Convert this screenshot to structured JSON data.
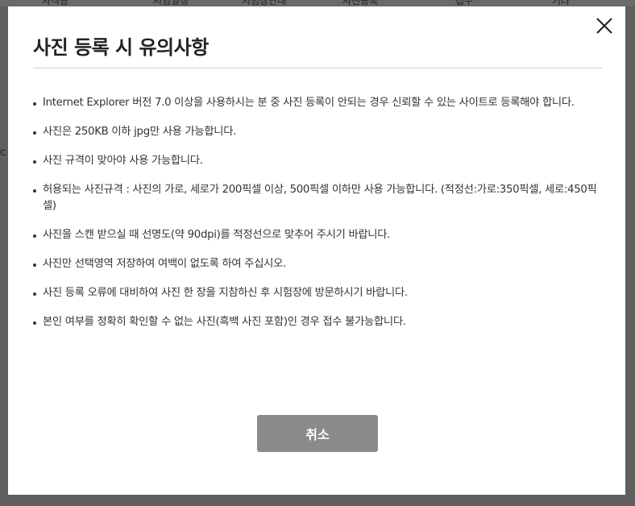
{
  "background": {
    "tabs": [
      "자격증",
      "시험일정",
      "시험장안내",
      "사진등록",
      "접수",
      "기타"
    ],
    "stub": "c"
  },
  "modal": {
    "title": "사진 등록 시 유의사항",
    "close_icon": "close-x-icon",
    "notes": [
      "Internet Explorer 버전 7.0 이상을 사용하시는 분 중 사진 등록이 안되는 경우 신뢰할 수 있는 사이트로 등록해야 합니다.",
      "사진은 250KB 이하 jpg만 사용 가능합니다.",
      "사진 규격이 맞아야 사용 가능합니다.",
      "허용되는 사진규격 : 사진의 가로, 세로가 200픽셀 이상, 500픽셀 이하만 사용 가능합니다. (적정선:가로:350픽셀, 세로:450픽셀)",
      "사진을 스캔 받으실 때 선명도(약 90dpi)를 적정선으로 맞추어 주시기 바랍니다.",
      "사진만 선택영역 저장하여 여백이 없도록 하여 주십시오.",
      "사진 등록 오류에 대비하여 사진 한 장을 지참하신 후 시험장에 방문하시기 바랍니다.",
      "본인 여부를 정확히 확인할 수 없는 사진(흑백 사진 포함)인 경우 접수 불가능합니다."
    ],
    "cancel_label": "취소"
  },
  "colors": {
    "overlay": "#5f5f5f",
    "modal_bg": "#ffffff",
    "button_bg": "#8a8a8a",
    "text": "#333333"
  }
}
